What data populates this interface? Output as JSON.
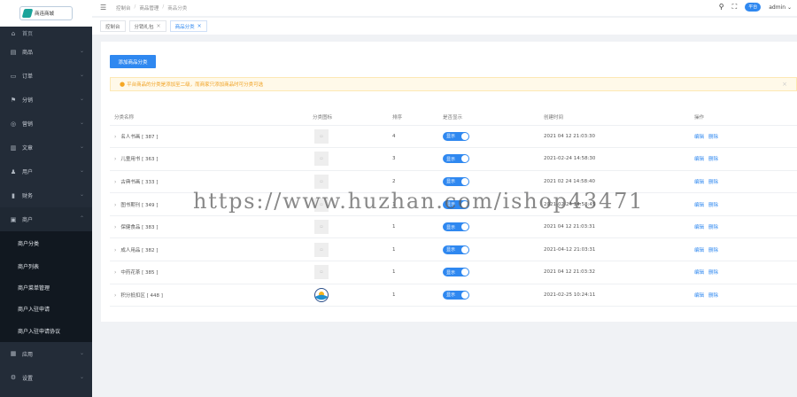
{
  "app": {
    "logo_text": "商连商城",
    "topbar": {
      "breadcrumb": [
        "控制台",
        "商品管理",
        "商品分类"
      ],
      "pill_label": "平台",
      "user": "admin"
    },
    "tabs": [
      {
        "label": "控制台",
        "closable": false,
        "active": false
      },
      {
        "label": "分销礼包",
        "closable": true,
        "active": false
      },
      {
        "label": "商品分类",
        "closable": true,
        "active": true
      }
    ]
  },
  "sidebar": {
    "items": [
      {
        "label": "首页",
        "icon": "home-icon",
        "glyph": "⌂"
      },
      {
        "label": "商品",
        "icon": "goods-icon",
        "glyph": "▤"
      },
      {
        "label": "订单",
        "icon": "order-icon",
        "glyph": "▭"
      },
      {
        "label": "分销",
        "icon": "flag-icon",
        "glyph": "⚑"
      },
      {
        "label": "营销",
        "icon": "marketing-icon",
        "glyph": "◎"
      },
      {
        "label": "文章",
        "icon": "article-icon",
        "glyph": "▥"
      },
      {
        "label": "用户",
        "icon": "user-icon",
        "glyph": "♟"
      },
      {
        "label": "财务",
        "icon": "finance-icon",
        "glyph": "▮"
      },
      {
        "label": "商户",
        "icon": "merchant-icon",
        "glyph": "▣"
      }
    ],
    "submenu": [
      "商户分类",
      "商户列表",
      "商户菜单管理",
      "商户入驻申请",
      "商户入驻申请协议"
    ],
    "bottom_items": [
      {
        "label": "应用",
        "icon": "apps-icon",
        "glyph": "▦"
      },
      {
        "label": "设置",
        "icon": "settings-icon",
        "glyph": "⚙"
      }
    ]
  },
  "page": {
    "add_button": "添加商品分类",
    "alert_text": "平台商品的分类是添加至二级，而商家只添加商品时可分类可选",
    "columns": [
      "分类名称",
      "分类图标",
      "排序",
      "是否显示",
      "创建时间",
      "操作"
    ],
    "rows": [
      {
        "name": "名人书画 [ 387 ]",
        "sort": "4",
        "show": "显示",
        "time": "2021 04 12 21:03:30",
        "edit": "编辑",
        "delete": "删除",
        "icon": "placeholder"
      },
      {
        "name": "儿童用书 [ 363 ]",
        "sort": "3",
        "show": "显示",
        "time": "2021-02-24 14:58:30",
        "edit": "编辑",
        "delete": "删除",
        "icon": "placeholder"
      },
      {
        "name": "古典书画 [ 333 ]",
        "sort": "2",
        "show": "显示",
        "time": "2021 02 24 14:58:40",
        "edit": "编辑",
        "delete": "删除",
        "icon": "placeholder"
      },
      {
        "name": "图书期刊 [ 349 ]",
        "sort": "1",
        "show": "显示",
        "time": "2021-02-24 14:58:45",
        "edit": "编辑",
        "delete": "删除",
        "icon": "placeholder"
      },
      {
        "name": "保健食品 [ 383 ]",
        "sort": "1",
        "show": "显示",
        "time": "2021 04 12 21:03:31",
        "edit": "编辑",
        "delete": "删除",
        "icon": "placeholder"
      },
      {
        "name": "成人用品 [ 382 ]",
        "sort": "1",
        "show": "显示",
        "time": "2021-04-12 21:03:31",
        "edit": "编辑",
        "delete": "删除",
        "icon": "placeholder"
      },
      {
        "name": "中药花茶 [ 385 ]",
        "sort": "1",
        "show": "显示",
        "time": "2021 04 12 21:03:32",
        "edit": "编辑",
        "delete": "删除",
        "icon": "placeholder"
      },
      {
        "name": "积分抵扣区 [ 448 ]",
        "sort": "1",
        "show": "显示",
        "time": "2021-02-25 10:24:11",
        "edit": "编辑",
        "delete": "删除",
        "icon": "logo"
      }
    ]
  },
  "watermark": "https://www.huzhan.com/ishop43471",
  "colors": {
    "primary": "#2f88f0",
    "sidebar_bg": "#232c38",
    "submenu_bg": "#111820",
    "alert_bg": "#fff9e9",
    "alert_text": "#f0a020"
  }
}
